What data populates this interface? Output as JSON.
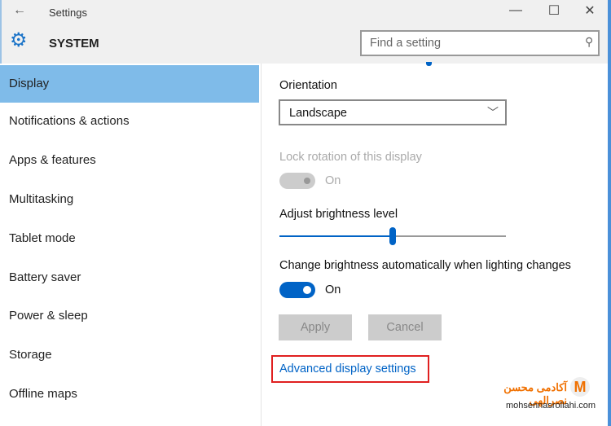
{
  "window": {
    "title": "Settings",
    "back_icon": "arrow-left-icon",
    "controls": [
      "minimize-icon",
      "maximize-icon",
      "close-icon"
    ]
  },
  "header": {
    "section": "SYSTEM",
    "section_icon": "gear-icon",
    "search_placeholder": "Find a setting",
    "search_icon": "search-icon"
  },
  "sidebar": {
    "items": [
      {
        "label": "Display",
        "selected": true
      },
      {
        "label": "Notifications & actions"
      },
      {
        "label": "Apps & features"
      },
      {
        "label": "Multitasking"
      },
      {
        "label": "Tablet mode"
      },
      {
        "label": "Battery saver"
      },
      {
        "label": "Power & sleep"
      },
      {
        "label": "Storage"
      },
      {
        "label": "Offline maps"
      }
    ]
  },
  "main": {
    "orientation": {
      "label": "Orientation",
      "value": "Landscape"
    },
    "lock_rotation": {
      "label": "Lock rotation of this display",
      "state": "On",
      "enabled": false
    },
    "brightness": {
      "label": "Adjust brightness level",
      "value_percent": 50
    },
    "auto_brightness": {
      "label": "Change brightness automatically when lighting changes",
      "state": "On"
    },
    "apply_label": "Apply",
    "cancel_label": "Cancel",
    "advanced_link": "Advanced display settings"
  },
  "watermark": {
    "brand": "آکادمی محسن نصرالهی",
    "url": "mohsennasrollahi.com"
  },
  "colors": {
    "accent": "#0063c6",
    "selected": "#7fbbe9",
    "highlight_box": "#e02020"
  }
}
